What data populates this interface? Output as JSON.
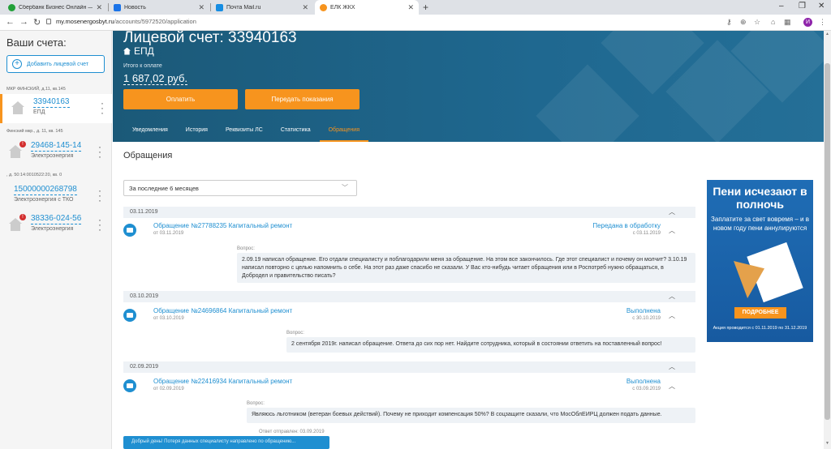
{
  "browser": {
    "tabs": [
      {
        "title": "Сбербанк Бизнес Онлайн — Инт",
        "color": "#21a038"
      },
      {
        "title": "Новость",
        "color": "#1a73e8"
      },
      {
        "title": "Почта Mail.ru",
        "color": "#168de2"
      },
      {
        "title": "ЕЛК ЖКХ",
        "color": "#f7941e"
      }
    ],
    "url_host": "my.mosenergosbyt.ru",
    "url_path": "/accounts/5972520/application",
    "profile_letter": "И"
  },
  "sidebar": {
    "title": "Ваши счета:",
    "add_label": "Добавить лицевой счет",
    "accounts": [
      {
        "address": "МКР ФИНСКИЙ, д.11, кв.145",
        "number": "33940163",
        "type": "ЕПД",
        "alert": ""
      },
      {
        "address": "Финский мкр., д. 11, кв. 145",
        "number": "29468-145-14",
        "type": "Электроэнергия",
        "alert": "!"
      },
      {
        "address": ", д. 50:14:0010522:20, кв. 0",
        "number": "15000000268798",
        "type": "Электроэнергия с ТКО",
        "alert": ""
      },
      {
        "address": "",
        "number": "38336-024-56",
        "type": "Электроэнергия",
        "alert": "!"
      }
    ]
  },
  "header": {
    "title": "Лицевой счет: 33940163",
    "subtitle": "ЕПД",
    "pay_label": "Итого к оплате",
    "amount": "1 687,02 руб.",
    "pay_button": "Оплатить",
    "readings_button": "Передать показания",
    "tabs": [
      "Уведомления",
      "История",
      "Реквизиты ЛС",
      "Статистика",
      "Обращения"
    ],
    "active_tab": "Обращения"
  },
  "main": {
    "title": "Обращения",
    "filter": "За последние 6 месяцев",
    "question_label": "Вопрос:",
    "answer_label": "Ответ отправлен: 03.09.2019",
    "requests": [
      {
        "date": "03.11.2019",
        "title": "Обращение №27788235 Капитальный ремонт",
        "created": "от 03.11.2019",
        "status": "Передана в обработку",
        "status_date": "с 03.11.2019",
        "question": "2.09.19 написал обращение. Его отдали специалисту и поблагодарили меня за обращение. На этом все закончилось. Где этот специалист и почему он молчит? 3.10.19 написал повторно с целью напомнить о себе. На этот раз даже спасибо не сказали. У Вас кто-нибудь читает обращения или в Роспотреб нужно обращаться, в Добродел и правительство писать?"
      },
      {
        "date": "03.10.2019",
        "title": "Обращение №24696864 Капитальный ремонт",
        "created": "от 03.10.2019",
        "status": "Выполнена",
        "status_date": "с 30.10.2019",
        "question": "2 сентября 2019г. написал обращение. Ответа до сих пор нет. Найдите сотрудника, который в состоянии ответить на поставленный вопрос!"
      },
      {
        "date": "02.09.2019",
        "title": "Обращение №22416934 Капитальный ремонт",
        "created": "от 02.09.2019",
        "status": "Выполнена",
        "status_date": "с 03.09.2019",
        "question": "Являюсь льготником (ветеран боевых действий). Почему не приходит компенсация 50%? В соцзащите сказали, что МосОблЕИРЦ должен подать данные."
      }
    ],
    "answer_preview": "Добрый день! Потеря данных специалисту направлено по обращению..."
  },
  "promo": {
    "headline": "Пени исчезают в полночь",
    "text": "Заплатите за свет вовремя – и в новом году пени аннулируются",
    "button": "ПОДРОБНЕЕ",
    "footer": "Акция проводится с 01.11.2019 по 31.12.2019"
  }
}
